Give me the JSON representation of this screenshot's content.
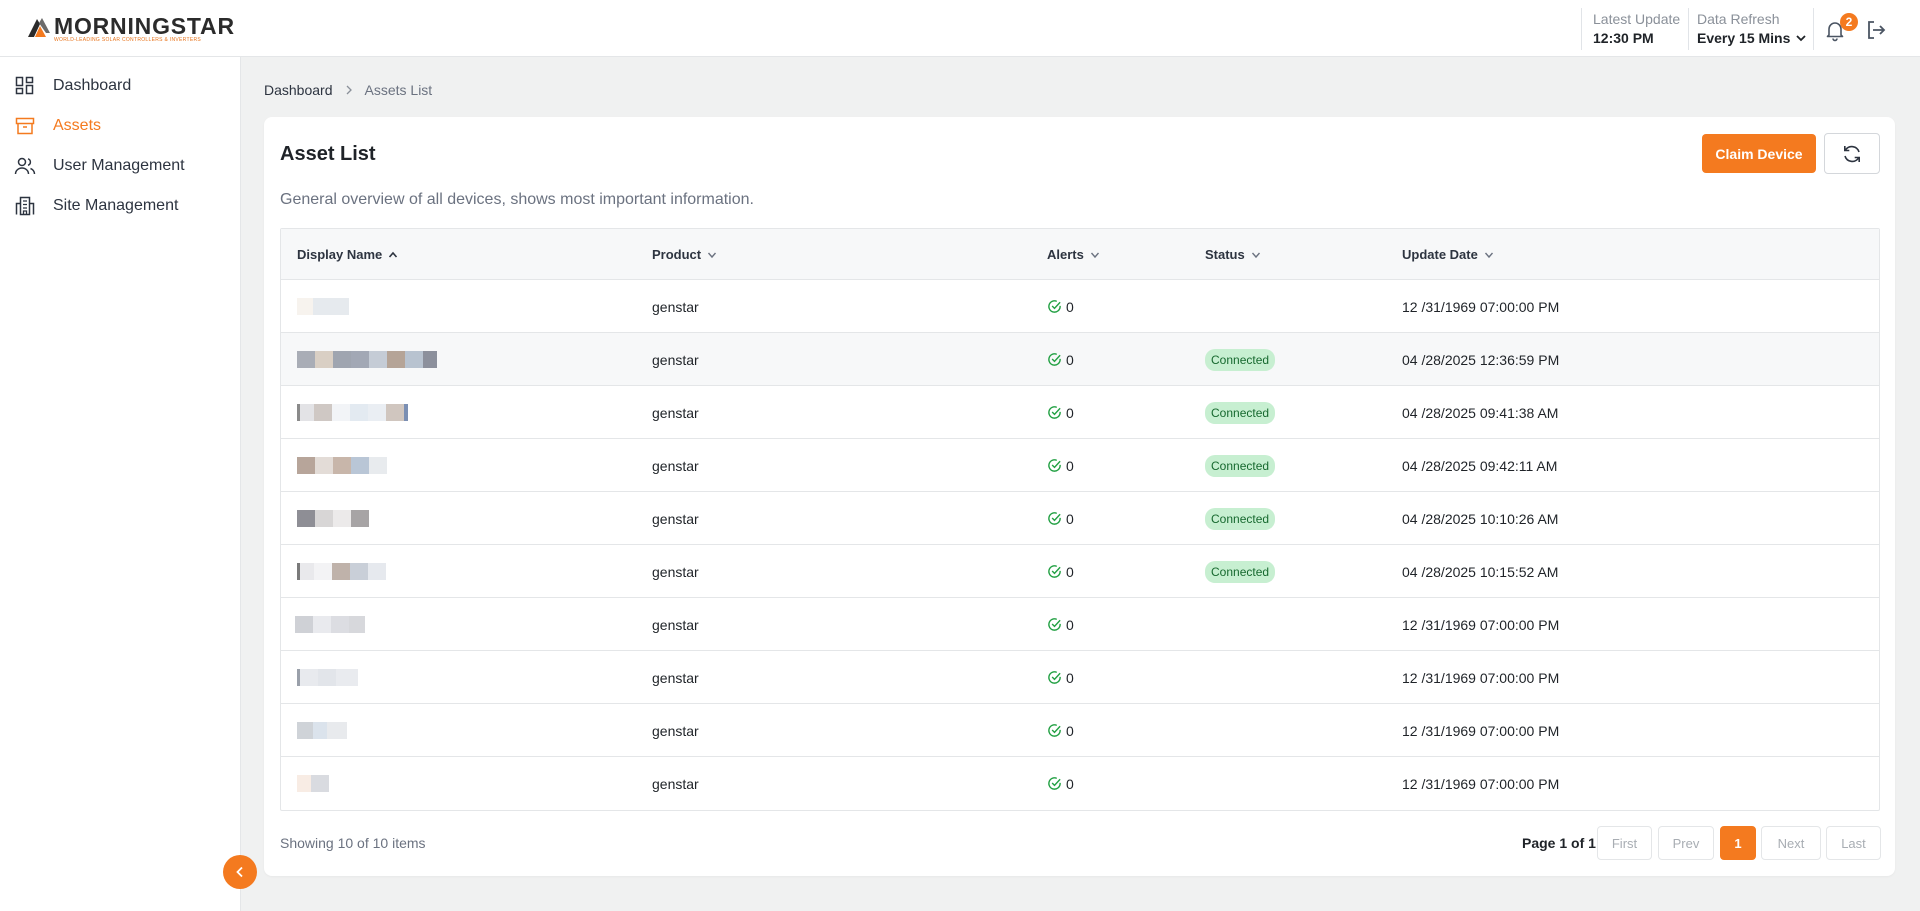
{
  "brand": {
    "name": "MORNINGSTAR",
    "tagline": "WORLD-LEADING SOLAR CONTROLLERS & INVERTERS",
    "accent": "#f47a1f"
  },
  "header": {
    "latest_update_label": "Latest Update",
    "latest_update_value": "12:30 PM",
    "data_refresh_label": "Data Refresh",
    "data_refresh_value": "Every 15 Mins",
    "notifications_count": "2"
  },
  "sidebar": {
    "items": [
      {
        "label": "Dashboard",
        "icon": "dashboard-icon",
        "active": false
      },
      {
        "label": "Assets",
        "icon": "archive-icon",
        "active": true
      },
      {
        "label": "User Management",
        "icon": "users-icon",
        "active": false
      },
      {
        "label": "Site Management",
        "icon": "building-icon",
        "active": false
      }
    ]
  },
  "breadcrumb": {
    "home": "Dashboard",
    "current": "Assets List"
  },
  "card": {
    "title": "Asset List",
    "description": "General overview of all devices, shows most important information.",
    "claim_button": "Claim Device"
  },
  "table": {
    "columns": [
      "Display Name",
      "Product",
      "Alerts",
      "Status",
      "Update Date"
    ],
    "rows": [
      {
        "product": "genstar",
        "alerts": "0",
        "status": "",
        "date": "12 /31/1969 07:00:00 PM"
      },
      {
        "product": "genstar",
        "alerts": "0",
        "status": "Connected",
        "date": "04 /28/2025 12:36:59 PM"
      },
      {
        "product": "genstar",
        "alerts": "0",
        "status": "Connected",
        "date": "04 /28/2025 09:41:38 AM"
      },
      {
        "product": "genstar",
        "alerts": "0",
        "status": "Connected",
        "date": "04 /28/2025 09:42:11 AM"
      },
      {
        "product": "genstar",
        "alerts": "0",
        "status": "Connected",
        "date": "04 /28/2025 10:10:26 AM"
      },
      {
        "product": "genstar",
        "alerts": "0",
        "status": "Connected",
        "date": "04 /28/2025 10:15:52 AM"
      },
      {
        "product": "genstar",
        "alerts": "0",
        "status": "",
        "date": "12 /31/1969 07:00:00 PM"
      },
      {
        "product": "genstar",
        "alerts": "0",
        "status": "",
        "date": "12 /31/1969 07:00:00 PM"
      },
      {
        "product": "genstar",
        "alerts": "0",
        "status": "",
        "date": "12 /31/1969 07:00:00 PM"
      },
      {
        "product": "genstar",
        "alerts": "0",
        "status": "",
        "date": "12 /31/1969 07:00:00 PM"
      }
    ]
  },
  "footer": {
    "showing": "Showing 10 of 10 items",
    "page_info": "Page 1 of 1",
    "first": "First",
    "prev": "Prev",
    "current_page": "1",
    "next": "Next",
    "last": "Last"
  }
}
